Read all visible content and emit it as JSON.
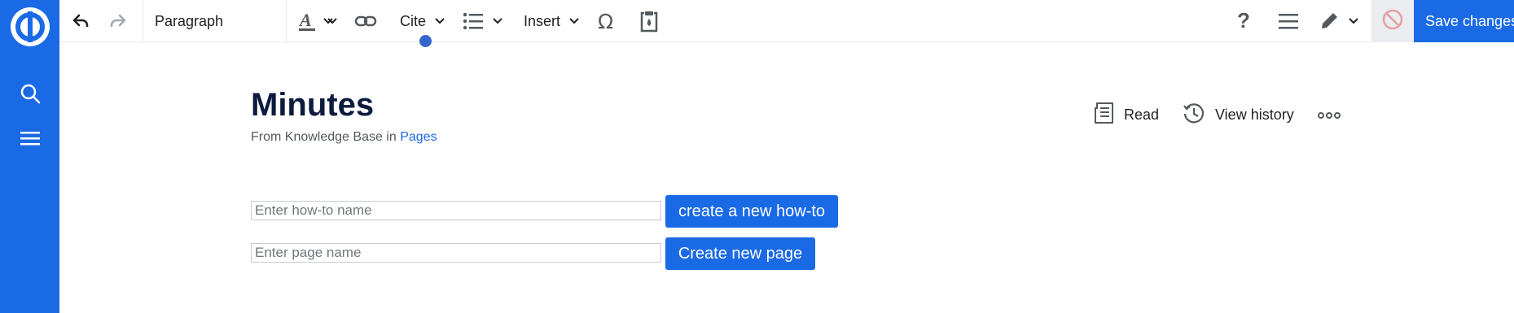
{
  "toolbar": {
    "paragraph_label": "Paragraph",
    "cite_label": "Cite",
    "insert_label": "Insert",
    "save_label": "Save changes"
  },
  "page": {
    "title": "Minutes",
    "subtitle_prefix": "From Knowledge Base in ",
    "subtitle_link": "Pages"
  },
  "actions": {
    "read_label": "Read",
    "view_history_label": "View history"
  },
  "forms": {
    "howto_placeholder": "Enter how-to name",
    "howto_button": "create a new how-to",
    "page_placeholder": "Enter page name",
    "page_button": "Create new page"
  },
  "colors": {
    "brand": "#1a6ae6",
    "title": "#0d1b3e",
    "active_indicator": "#3366cc"
  },
  "icons": {
    "sidebar": [
      "logo-icon",
      "search-icon",
      "menu-icon"
    ],
    "toolbar": [
      "undo-icon",
      "redo-icon",
      "text-style-icon",
      "link-icon",
      "list-icon",
      "special-character-icon",
      "clipboard-icon",
      "help-icon",
      "page-options-icon",
      "edit-pencil-icon",
      "cancel-icon"
    ],
    "page_actions": [
      "read-icon",
      "history-icon",
      "more-icon"
    ]
  }
}
